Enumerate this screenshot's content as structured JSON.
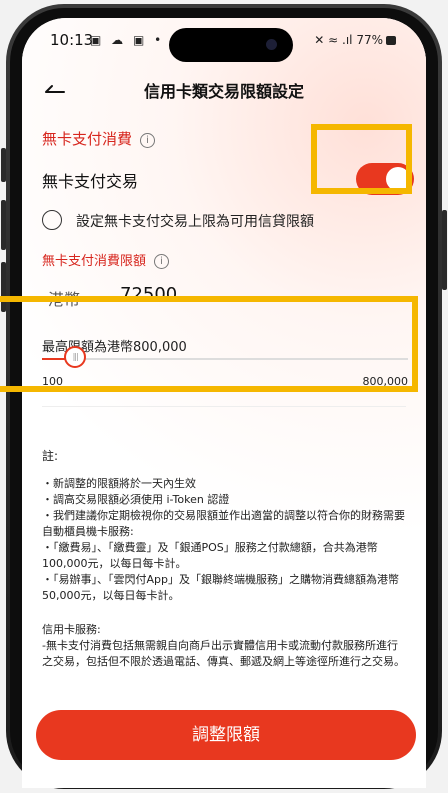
{
  "status_bar": {
    "time": "10:13",
    "left_icons": "▣ ☁ ▣ •",
    "right_icons": "✕ ≈ .ıl 77%"
  },
  "nav": {
    "title": "信用卡類交易限額設定"
  },
  "cardless": {
    "section_title": "無卡支付消費",
    "toggle_label": "無卡支付交易",
    "toggle_on": true,
    "radio_label": "設定無卡支付交易上限為可用信貸限額",
    "limit_title": "無卡支付消費限額",
    "currency": "港幣",
    "amount": "72500"
  },
  "slider": {
    "max_label": "最高限額為港幣800,000",
    "min_text": "100",
    "max_text": "800,000",
    "min_value": 100,
    "max_value": 800000,
    "value": 72500,
    "thumb_glyph": "|||"
  },
  "notes": {
    "heading": "註:",
    "lines": [
      "・新調整的限額將於一天內生效",
      "・調高交易限額必須使用 i-Token 認證",
      "・我們建議你定期檢視你的交易限額並作出適當的調整以符合你的財務需要",
      "自動櫃員機卡服務:",
      "・「繳費易」、「繳費靈」及「銀通POS」服務之付款總額，合共為港幣100,000元，以每日每卡計。",
      "・「易辦事」、「雲閃付App」及「銀聯終端機服務」之購物消費總額為港幣50,000元，以每日每卡計。"
    ],
    "credit_heading": "信用卡服務:",
    "credit_text": "-無卡支付消費包括無需親自向商戶出示實體信用卡或流動付款服務所進行之交易，包括但不限於透過電話、傳真、郵遞及網上等途徑所進行之交易。"
  },
  "action": {
    "button_label": "調整限額"
  },
  "colors": {
    "accent": "#e8381f",
    "highlight": "#f5b700"
  }
}
